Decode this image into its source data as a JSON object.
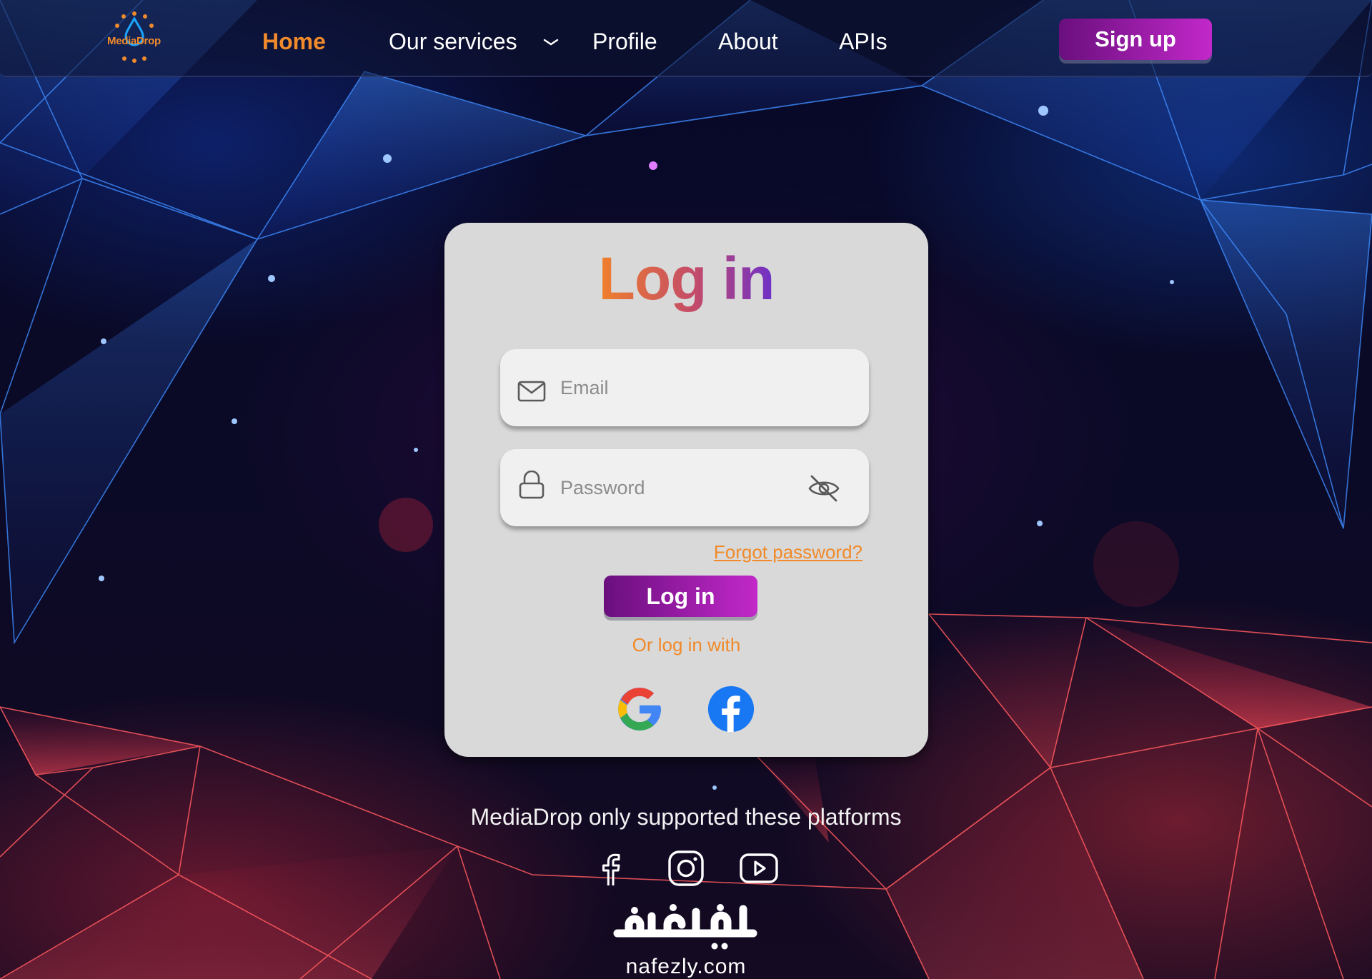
{
  "brand": {
    "logo_text": "MediaDrop",
    "accent": "#f08a2a",
    "gradient_start": "#6a0f7e",
    "gradient_end": "#c228c9"
  },
  "nav": {
    "home": "Home",
    "services": "Our services",
    "profile": "Profile",
    "about": "About",
    "apis": "APIs",
    "signup": "Sign up"
  },
  "login": {
    "title": "Log in",
    "email_placeholder": "Email",
    "password_placeholder": "Password",
    "forgot": "Forgot password?",
    "button": "Log in",
    "or_text": "Or log in with",
    "social_icons": [
      "google-icon",
      "facebook-icon"
    ]
  },
  "footer": {
    "supported_text": "MediaDrop only supported these platforms",
    "platform_icons": [
      "facebook-icon",
      "instagram-icon",
      "youtube-icon"
    ]
  },
  "watermark": {
    "arabic": "نفذلي",
    "latin": "nafezly.com"
  }
}
